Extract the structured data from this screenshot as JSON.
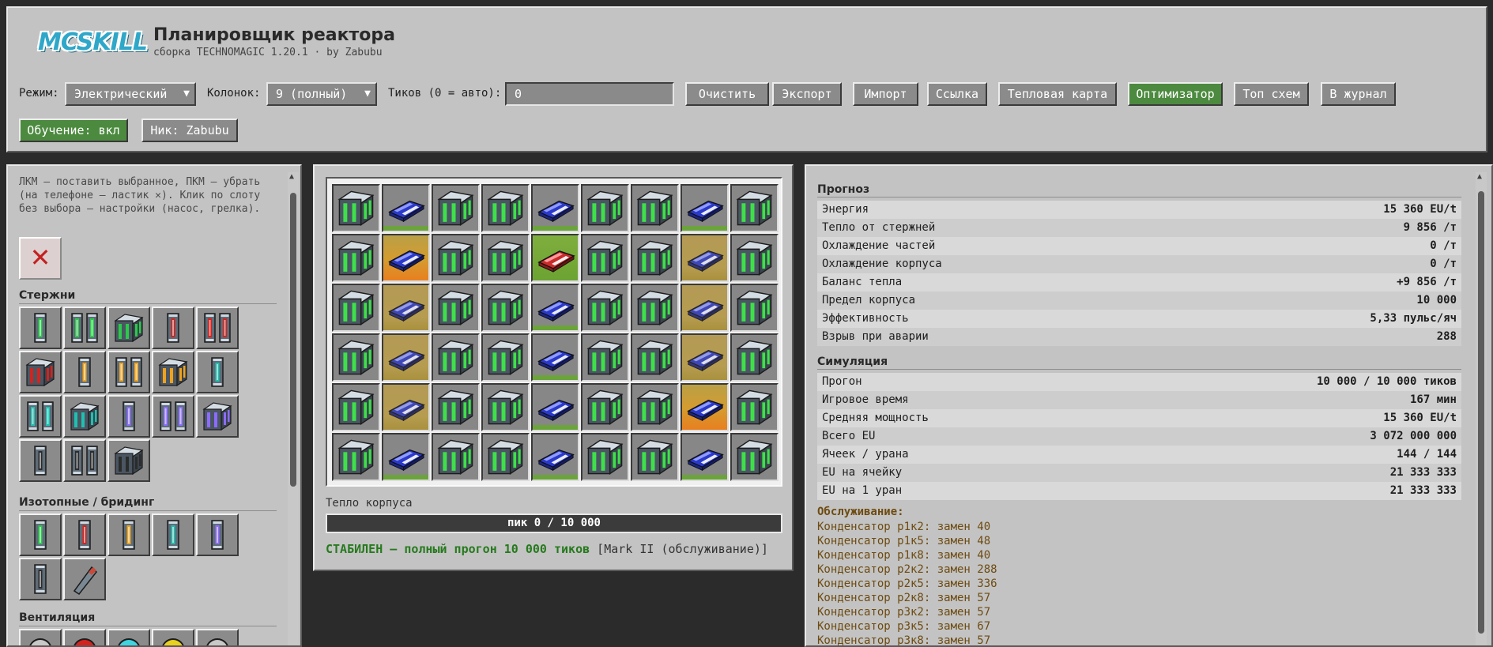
{
  "header": {
    "logo_text": "MCSKILL",
    "title": "Планировщик реактора",
    "subtitle": "сборка TECHNOMAGIC 1.20.1 · by Zabubu",
    "mode_label": "Режим:",
    "mode_value": "Электрический",
    "columns_label": "Колонок:",
    "columns_value": "9 (полный)",
    "ticks_label": "Тиков (0 = авто):",
    "ticks_value": "0",
    "buttons": {
      "clear": "Очистить",
      "export": "Экспорт",
      "import": "Импорт",
      "link": "Ссылка",
      "heatmap": "Тепловая карта",
      "optimizer": "Оптимизатор",
      "top": "Топ схем",
      "journal": "В журнал",
      "tutorial": "Обучение: вкл",
      "nick": "Ник: Zabubu"
    },
    "active_color": "#4c8a3f"
  },
  "palette": {
    "hint": "ЛКМ — поставить выбранное, ПКМ — убрать (на телефоне — ластик ✕). Клик по слоту без выбора — настройки (насос, грелка).",
    "eraser_symbol": "✕",
    "sections": {
      "rods": "Стержни",
      "isotopes": "Изотопные / бридинг",
      "vents": "Вентиляция"
    },
    "rods": [
      {
        "icon": "uranium-single-rod-icon",
        "color": "#2cc94a",
        "count": 1
      },
      {
        "icon": "uranium-dual-rod-icon",
        "color": "#2cc94a",
        "count": 2
      },
      {
        "icon": "uranium-quad-rod-icon",
        "color": "#2cc94a",
        "count": 4
      },
      {
        "icon": "mox-single-rod-icon",
        "color": "#d4231e",
        "count": 1
      },
      {
        "icon": "mox-dual-rod-icon",
        "color": "#d4231e",
        "count": 2
      },
      {
        "icon": "mox-quad-rod-icon",
        "color": "#d4231e",
        "count": 4
      },
      {
        "icon": "thorium-single-rod-icon",
        "color": "#f0a21c",
        "count": 1
      },
      {
        "icon": "thorium-dual-rod-icon",
        "color": "#f0a21c",
        "count": 2
      },
      {
        "icon": "thorium-quad-rod-icon",
        "color": "#f0a21c",
        "count": 4
      },
      {
        "icon": "cyan-single-rod-icon",
        "color": "#1fc0b0",
        "count": 1
      },
      {
        "icon": "cyan-dual-rod-icon",
        "color": "#1fc0b0",
        "count": 2
      },
      {
        "icon": "cyan-quad-rod-icon",
        "color": "#1fc0b0",
        "count": 4
      },
      {
        "icon": "violet-single-rod-icon",
        "color": "#8c6cff",
        "count": 1
      },
      {
        "icon": "violet-dual-rod-icon",
        "color": "#8c6cff",
        "count": 2
      },
      {
        "icon": "violet-quad-rod-icon",
        "color": "#8c6cff",
        "count": 4
      },
      {
        "icon": "depleted-single-rod-icon",
        "color": "#2b2b2b",
        "count": 1
      },
      {
        "icon": "depleted-dual-rod-icon",
        "color": "#2b2b2b",
        "count": 2
      },
      {
        "icon": "depleted-quad-rod-icon",
        "color": "#2b2b2b",
        "count": 4
      }
    ],
    "isotopes": [
      {
        "icon": "isotope-green-cell-icon",
        "color": "#2cc94a",
        "count": 1
      },
      {
        "icon": "isotope-red-cell-icon",
        "color": "#d4231e",
        "count": 1
      },
      {
        "icon": "isotope-orange-cell-icon",
        "color": "#f0a21c",
        "count": 1
      },
      {
        "icon": "isotope-cyan-cell-icon",
        "color": "#1fc0b0",
        "count": 1
      },
      {
        "icon": "isotope-violet-cell-icon",
        "color": "#8c6cff",
        "count": 1
      },
      {
        "icon": "isotope-empty-cell-icon",
        "color": "#2b2b2b",
        "count": 1
      },
      {
        "icon": "breeder-tool-icon",
        "color": "#c84a3a",
        "count": 0
      }
    ],
    "vents": [
      {
        "icon": "vent-grey-icon",
        "color": "#c8c8c8"
      },
      {
        "icon": "vent-red-icon",
        "color": "#d4231e"
      },
      {
        "icon": "vent-cyan-icon",
        "color": "#3fd4e0"
      },
      {
        "icon": "vent-yellow-icon",
        "color": "#e8d11c"
      },
      {
        "icon": "vent-grey-2-icon",
        "color": "#c8c8c8"
      }
    ]
  },
  "reactor": {
    "columns": 9,
    "rows": 6,
    "grid": [
      [
        "Q",
        "C",
        "Q",
        "Q",
        "C",
        "Q",
        "Q",
        "C",
        "Q"
      ],
      [
        "Q",
        "H",
        "Q",
        "Q",
        "R",
        "Q",
        "Q",
        "W",
        "Q"
      ],
      [
        "Q",
        "W",
        "Q",
        "Q",
        "C",
        "Q",
        "Q",
        "W",
        "Q"
      ],
      [
        "Q",
        "W",
        "Q",
        "Q",
        "C",
        "Q",
        "Q",
        "W",
        "Q"
      ],
      [
        "Q",
        "W",
        "Q",
        "Q",
        "C",
        "Q",
        "Q",
        "H",
        "Q"
      ],
      [
        "Q",
        "C",
        "Q",
        "Q",
        "C",
        "Q",
        "Q",
        "C",
        "Q"
      ]
    ],
    "hull_heat_label": "Тепло корпуса",
    "hull_heat_text": "пик 0 / 10 000",
    "hull_heat_fraction": 0,
    "status_ok": "СТАБИЛЕН — полный прогон 10 000 тиков",
    "status_mark": "[Mark II (обслуживание)]"
  },
  "stats": {
    "forecast_title": "Прогноз",
    "forecast": [
      {
        "label": "Энергия",
        "value": "15 360 EU/t"
      },
      {
        "label": "Тепло от стержней",
        "value": "9 856 /т"
      },
      {
        "label": "Охлаждение частей",
        "value": "0 /т"
      },
      {
        "label": "Охлаждение корпуса",
        "value": "0 /т"
      },
      {
        "label": "Баланс тепла",
        "value": "+9 856 /т"
      },
      {
        "label": "Предел корпуса",
        "value": "10 000"
      },
      {
        "label": "Эффективность",
        "value": "5,33 пульс/яч"
      },
      {
        "label": "Взрыв при аварии",
        "value": "288"
      }
    ],
    "simulation_title": "Симуляция",
    "simulation": [
      {
        "label": "Прогон",
        "value": "10 000 / 10 000 тиков"
      },
      {
        "label": "Игровое время",
        "value": "167 мин"
      },
      {
        "label": "Средняя мощность",
        "value": "15 360 EU/t"
      },
      {
        "label": "Всего EU",
        "value": "3 072 000 000"
      },
      {
        "label": "Ячеек / урана",
        "value": "144 / 144"
      },
      {
        "label": "EU на ячейку",
        "value": "21 333 333"
      },
      {
        "label": "EU на 1 уран",
        "value": "21 333 333"
      }
    ],
    "maintenance_title": "Обслуживание:",
    "maintenance": [
      "Конденсатор р1к2: замен 40",
      "Конденсатор р1к5: замен 48",
      "Конденсатор р1к8: замен 40",
      "Конденсатор р2к2: замен 288",
      "Конденсатор р2к5: замен 336",
      "Конденсатор р2к8: замен 57",
      "Конденсатор р3к2: замен 57",
      "Конденсатор р3к5: замен 67",
      "Конденсатор р3к8: замен 57"
    ]
  }
}
